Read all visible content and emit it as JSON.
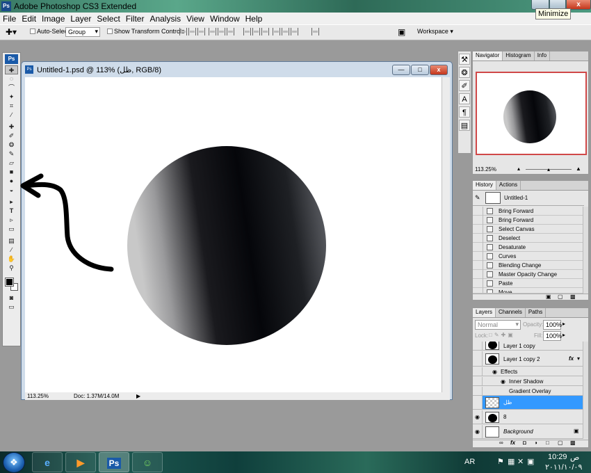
{
  "app": {
    "title": "Adobe Photoshop CS3 Extended",
    "badge": "Ps",
    "tooltip": "Minimize",
    "close_glyph": "x"
  },
  "menu": [
    "File",
    "Edit",
    "Image",
    "Layer",
    "Select",
    "Filter",
    "Analysis",
    "View",
    "Window",
    "Help"
  ],
  "options": {
    "auto_select_label": "Auto-Select:",
    "auto_select_value": "Group",
    "transform_label": "Show Transform Controls",
    "workspace_label": "Workspace"
  },
  "document": {
    "title": "Untitled-1.psd @ 113% (ظل, RGB/8)",
    "zoom": "113.25%",
    "doc_size": "Doc: 1.37M/14.0M",
    "icon": "Ps"
  },
  "navigator": {
    "tabs": [
      "Navigator",
      "Histogram",
      "Info"
    ],
    "zoom": "113.25%"
  },
  "history": {
    "tabs": [
      "History",
      "Actions"
    ],
    "snapshot": "Untitled-1",
    "items": [
      "Bring Forward",
      "Bring Forward",
      "Select Canvas",
      "Deselect",
      "Desaturate",
      "Curves",
      "Blending Change",
      "Master Opacity Change",
      "Paste",
      "Move"
    ]
  },
  "layers": {
    "tabs": [
      "Layers",
      "Channels",
      "Paths"
    ],
    "blend_mode": "Normal",
    "opacity_label": "Opacity:",
    "opacity": "100%",
    "lock_label": "Lock:",
    "fill_label": "Fill:",
    "fill": "100%",
    "rows": [
      {
        "name": "Layer 1 copy"
      },
      {
        "name": "Layer 1 copy 2",
        "fx": "fx"
      },
      {
        "name": "Effects"
      },
      {
        "name": "Inner Shadow"
      },
      {
        "name": "Gradient Overlay"
      },
      {
        "name": "ظل"
      },
      {
        "name": "8"
      },
      {
        "name": "Background"
      }
    ]
  },
  "taskbar": {
    "ps_label": "Ps",
    "language": "AR",
    "time": "10:29",
    "ampm": "ص",
    "date": "٢٠١١/١٠/٠٩"
  },
  "colors": {
    "selection": "#3399ff",
    "nav_view_box": "#d04848"
  }
}
